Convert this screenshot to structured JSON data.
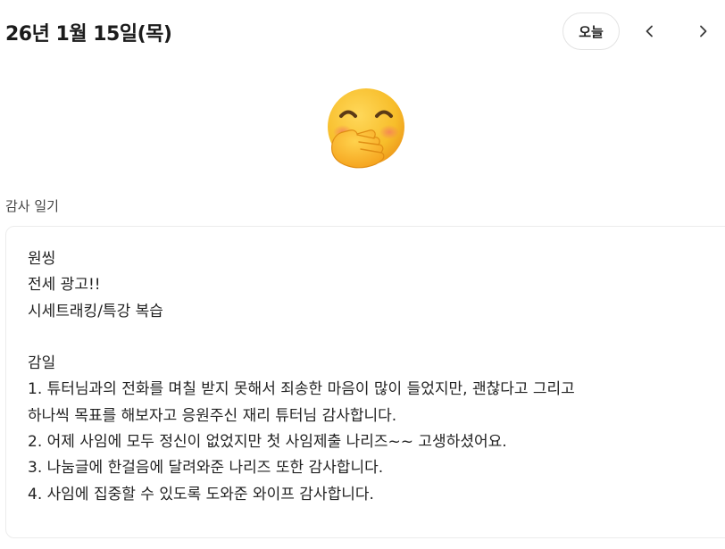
{
  "header": {
    "date": "26년 1월 15일(목)",
    "today_label": "오늘",
    "prev_icon": "chevron-left-icon",
    "next_icon": "chevron-right-icon"
  },
  "mood": {
    "emoji": "face-with-hand-over-mouth-icon"
  },
  "diary": {
    "section_label": "감사 일기",
    "content": "원씽\n전세 광고!!\n시세트래킹/특강 복습\n\n감일\n1. 튜터님과의 전화를 며칠 받지 못해서 죄송한 마음이 많이 들었지만, 괜찮다고 그리고\n하나씩 목표를 해보자고 응원주신 재리 튜터님 감사합니다.\n2. 어제 사임에 모두 정신이 없었지만 첫 사임제출 나리즈~~ 고생하셨어요.\n3. 나눔글에 한걸음에 달려와준 나리즈 또한 감사합니다.\n4. 사임에 집중할 수 있도록 도와준 와이프 감사합니다."
  },
  "colors": {
    "emoji_face": "#f9c12e",
    "emoji_hand": "#fbb52a",
    "emoji_blush": "#f38a5c",
    "border": "#e3e3e3"
  }
}
